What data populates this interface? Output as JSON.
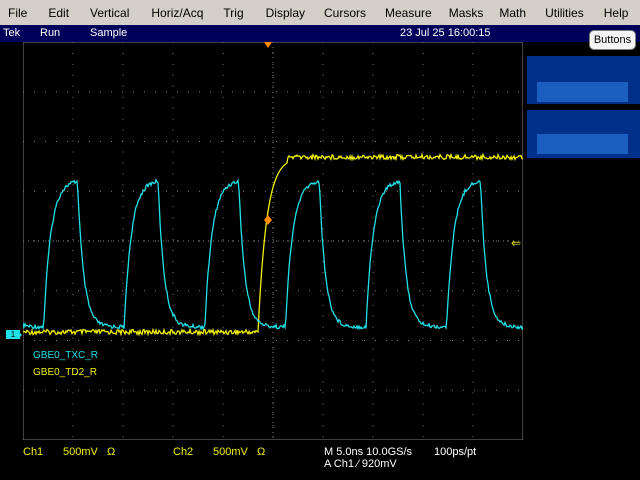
{
  "menu": [
    "File",
    "Edit",
    "Vertical",
    "Horiz/Acq",
    "Trig",
    "Display",
    "Cursors",
    "Measure",
    "Masks",
    "Math",
    "Utilities",
    "Help"
  ],
  "titlebar": {
    "brand": "Tek",
    "run": "Run",
    "mode": "Sample",
    "datetime": "23 Jul 25 16:00:15"
  },
  "buttons_label": "Buttons",
  "waveforms": {
    "ch1_label": "GBE0_TXC_R",
    "ch2_label": "GBE0_TD2_R",
    "ch1_color": "#20e0e8",
    "ch2_color": "#f0f000",
    "ch_marker": "1"
  },
  "status": {
    "ch1": "Ch1",
    "ch1_scale": "500mV",
    "ch1_term": "Ω",
    "ch2": "Ch2",
    "ch2_scale": "500mV",
    "ch2_term": "Ω",
    "timebase": "M 5.0ns 10.0GS/s",
    "resolution": "100ps/pt",
    "trigger": "A  Ch1  ⁄  920mV"
  },
  "colors": {
    "menubar": "#d4d0c8",
    "titlebar": "#00005a",
    "panel": "#00308a",
    "panel_inner": "#1a5fbf"
  }
}
